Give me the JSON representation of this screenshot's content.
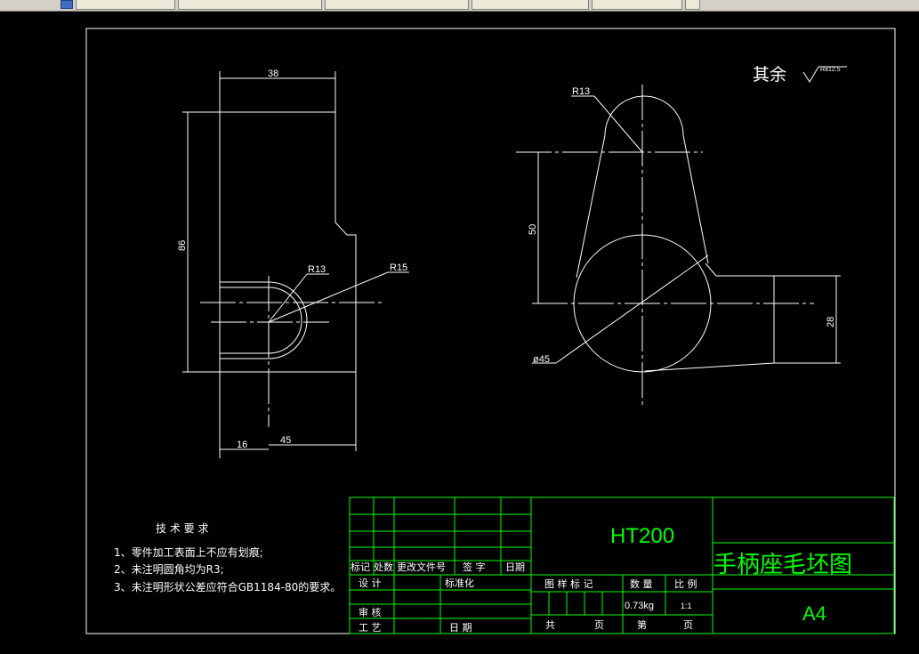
{
  "window": {
    "tabs": [
      "",
      "",
      "",
      "",
      "",
      ""
    ]
  },
  "drawing": {
    "surface_note": {
      "label": "其余",
      "value": "Ra12.5"
    },
    "left_view": {
      "dims": {
        "width_top": "38",
        "height": "86",
        "r_inner": "R13",
        "r_outer": "R15",
        "dist_16": "16",
        "dist_45": "45"
      }
    },
    "right_view": {
      "dims": {
        "r_top": "R13",
        "center_dist": "50",
        "diameter": "ø45",
        "boss": "28"
      }
    },
    "tech_requirements": {
      "title": "技 术 要 求",
      "items": [
        "1、零件加工表面上不应有划痕;",
        "2、未注明圆角均为R3;",
        "3、未注明形状公差应符合GB1184-80的要求。"
      ]
    },
    "title_block": {
      "material": "HT200",
      "part_name": "手柄座毛坯图",
      "sheet_size": "A4",
      "rev_row": {
        "mark": "标记",
        "count": "处数",
        "change_doc": "更改文件号",
        "sign": "签 字",
        "date": "日期"
      },
      "design": "设 计",
      "standardize": "标准化",
      "review": "审 核",
      "process": "工 艺",
      "date2": "日 期",
      "stage_mark": "图 样 标 记",
      "weight_label": "数 量",
      "scale_label": "比 例",
      "weight": "0.73kg",
      "scale": "1:1",
      "total": "共",
      "page_a": "页",
      "nth": "第",
      "page_b": "页"
    },
    "colors": {
      "line": "#ffffff",
      "title_green": "#00ff00",
      "background": "#000000"
    }
  }
}
